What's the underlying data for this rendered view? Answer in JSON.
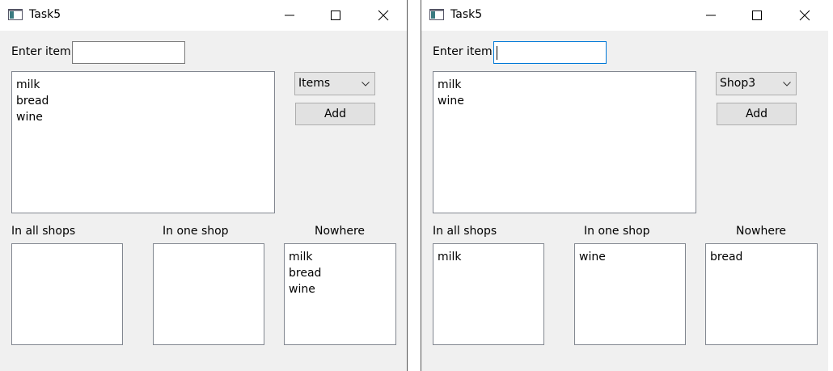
{
  "windows": [
    {
      "title": "Task5",
      "enter_label": "Enter item",
      "input_value": "",
      "items": [
        "milk",
        "bread",
        "wine"
      ],
      "combo_value": "Items",
      "add_label": "Add",
      "all_shops_label": "In all shops",
      "one_shop_label": "In one shop",
      "nowhere_label": "Nowhere",
      "all_shops": [],
      "one_shop": [],
      "nowhere": [
        "milk",
        "bread",
        "wine"
      ]
    },
    {
      "title": "Task5",
      "enter_label": "Enter item",
      "input_value": "",
      "items": [
        "milk",
        "wine"
      ],
      "combo_value": "Shop3",
      "add_label": "Add",
      "all_shops_label": "In all shops",
      "one_shop_label": "In one shop",
      "nowhere_label": "Nowhere",
      "all_shops": [
        "milk"
      ],
      "one_shop": [
        "wine"
      ],
      "nowhere": [
        "bread"
      ]
    }
  ],
  "icons": {
    "app": "app-window-icon",
    "minimize": "minimize-icon",
    "maximize": "maximize-icon",
    "close": "close-icon",
    "dropdown": "chevron-down-icon"
  }
}
